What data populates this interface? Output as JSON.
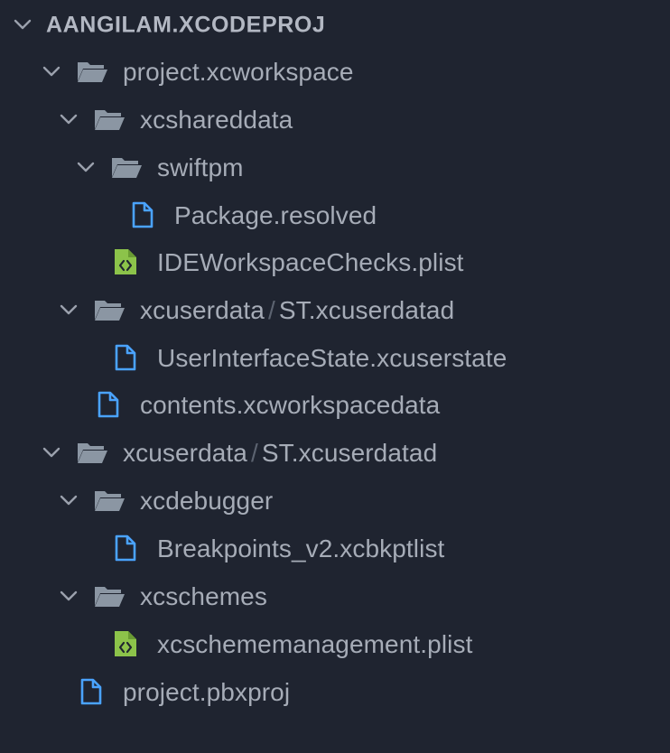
{
  "colors": {
    "background": "#1f2430",
    "text": "#a6acb7",
    "folder_icon": "#8b96a3",
    "file_icon": "#4aa3ff",
    "plist_icon": "#8cc34a",
    "chevron": "#9ba1ad"
  },
  "tree": {
    "root": {
      "label": "AANGILAM.XCODEPROJ",
      "icon": "chevron-down-icon"
    },
    "project_xcworkspace": {
      "label": "project.xcworkspace",
      "icon": "folder-open-icon"
    },
    "xcshareddata": {
      "label": "xcshareddata",
      "icon": "folder-open-icon"
    },
    "swiftpm": {
      "label": "swiftpm",
      "icon": "folder-open-icon"
    },
    "package_resolved": {
      "label": "Package.resolved",
      "icon": "file-icon"
    },
    "ide_workspace_checks": {
      "label": "IDEWorkspaceChecks.plist",
      "icon": "plist-file-icon"
    },
    "ws_xcuserdata": {
      "label_a": "xcuserdata",
      "separator": "/",
      "label_b": "ST.xcuserdatad",
      "icon": "folder-open-icon"
    },
    "user_interface_state": {
      "label": "UserInterfaceState.xcuserstate",
      "icon": "file-icon"
    },
    "contents_xcworkspacedata": {
      "label": "contents.xcworkspacedata",
      "icon": "file-icon"
    },
    "proj_xcuserdata": {
      "label_a": "xcuserdata",
      "separator": "/",
      "label_b": "ST.xcuserdatad",
      "icon": "folder-open-icon"
    },
    "xcdebugger": {
      "label": "xcdebugger",
      "icon": "folder-open-icon"
    },
    "breakpoints": {
      "label": "Breakpoints_v2.xcbkptlist",
      "icon": "file-icon"
    },
    "xcschemes": {
      "label": "xcschemes",
      "icon": "folder-open-icon"
    },
    "xcschememanagement": {
      "label": "xcschememanagement.plist",
      "icon": "plist-file-icon"
    },
    "project_pbxproj": {
      "label": "project.pbxproj",
      "icon": "file-icon"
    }
  }
}
